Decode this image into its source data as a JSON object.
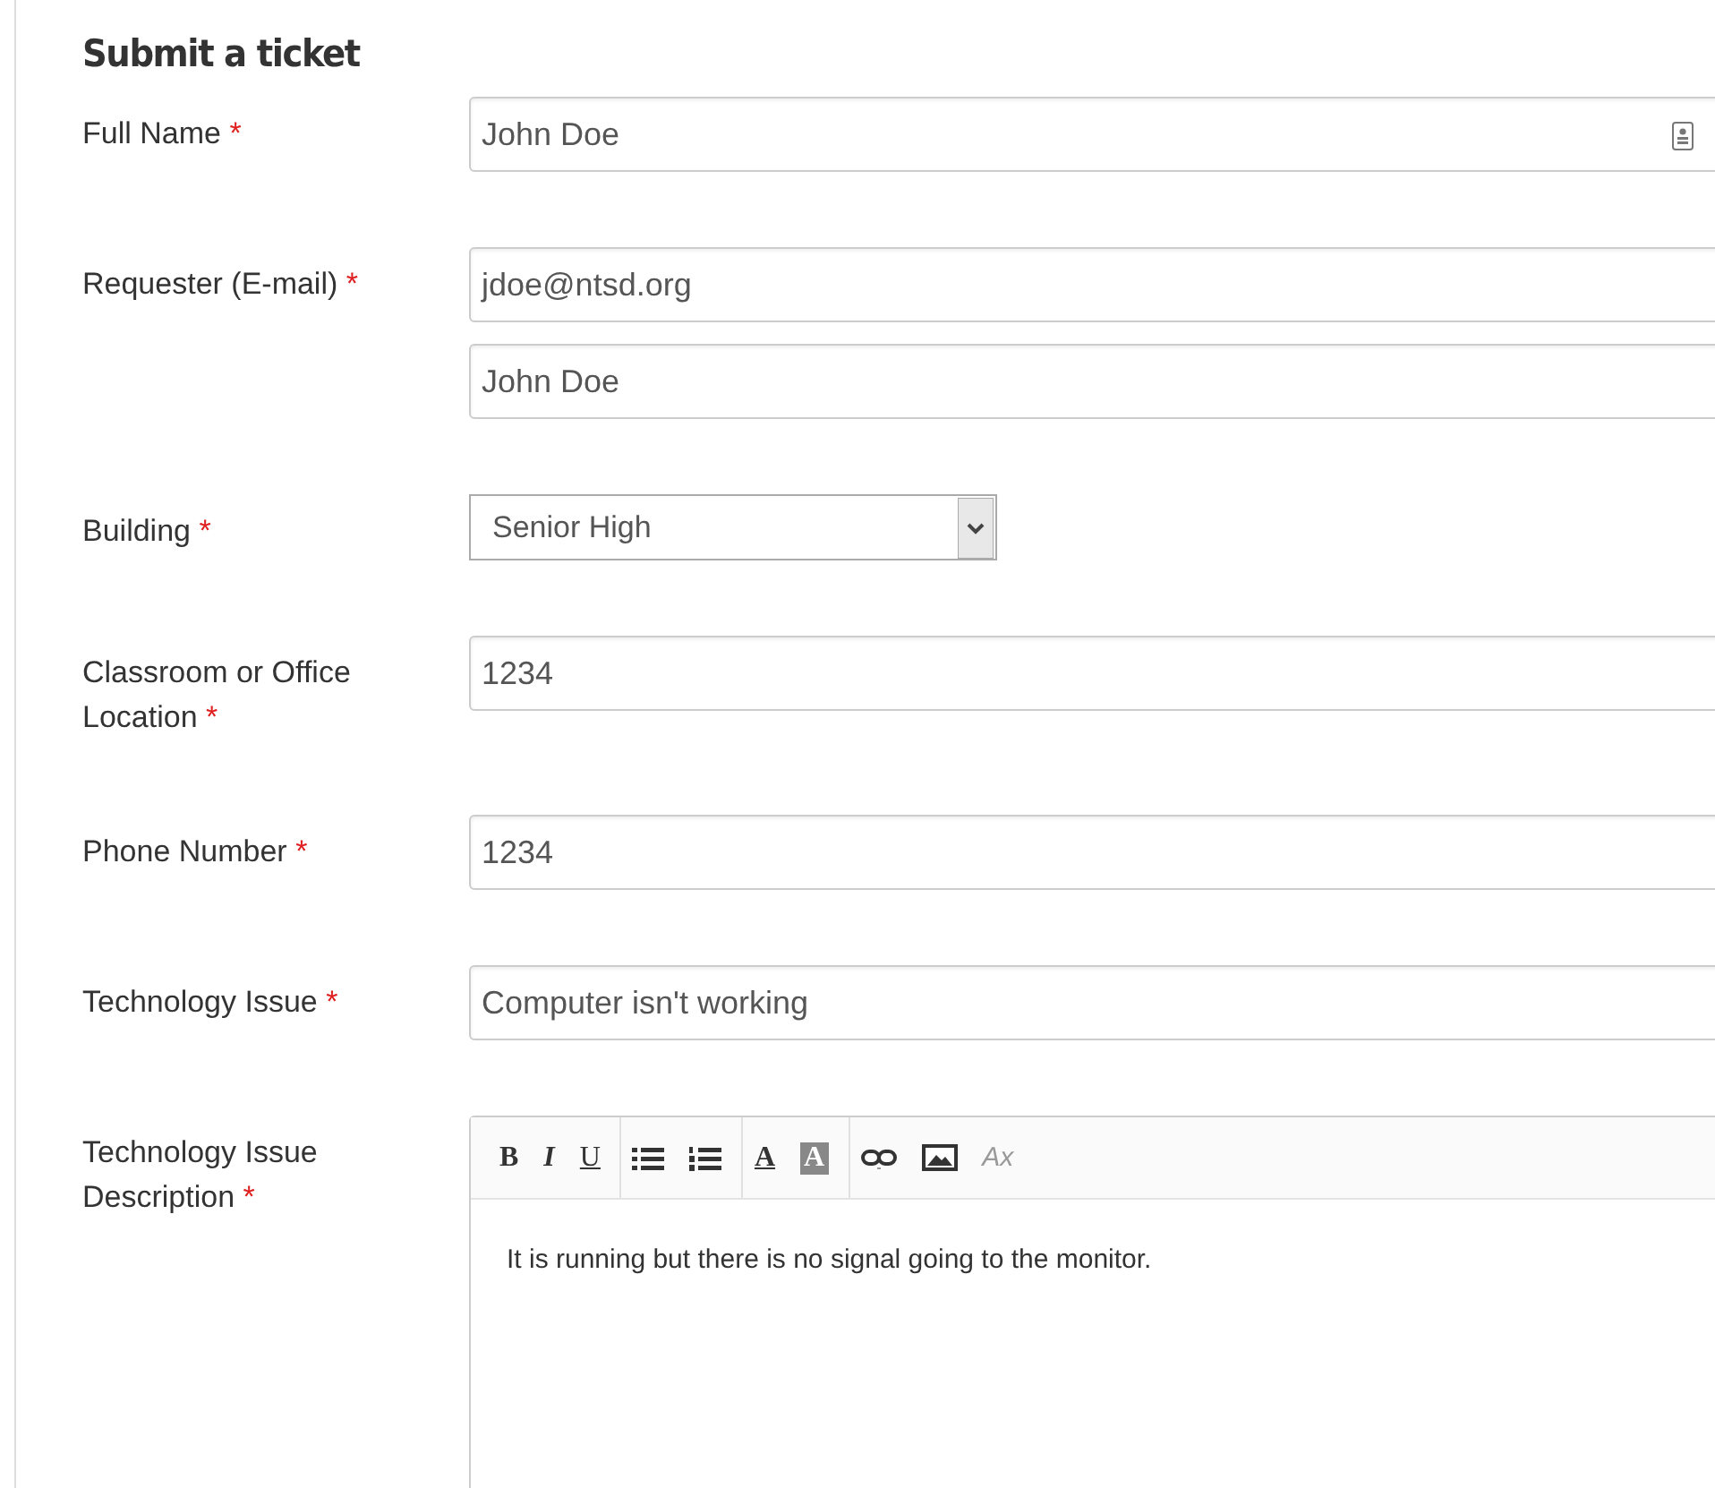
{
  "title": "Submit a ticket",
  "fields": [
    {
      "kind": "contact",
      "label": "Full Name",
      "required_mark": "*",
      "values": [
        "John Doe"
      ]
    },
    {
      "kind": "text",
      "label": "Requester (E-mail)",
      "required_mark": "*",
      "values": [
        "jdoe@ntsd.org",
        "John Doe"
      ]
    },
    {
      "kind": "select",
      "label": "Building",
      "required_mark": "*",
      "values": [
        "Senior High"
      ]
    },
    {
      "kind": "text",
      "label": "Classroom or Office Location",
      "required_mark": "*",
      "values": [
        "1234"
      ]
    },
    {
      "kind": "text",
      "label": "Phone Number",
      "required_mark": "*",
      "values": [
        "1234"
      ]
    },
    {
      "kind": "text",
      "label": "Technology Issue",
      "required_mark": "*",
      "values": [
        "Computer isn't working"
      ]
    },
    {
      "kind": "editor",
      "label": "Technology Issue Description",
      "required_mark": "*",
      "values": [
        "It is running but there is no signal going to the monitor."
      ],
      "toolbar": [
        [
          {
            "kind": "bold",
            "label": "B"
          },
          {
            "kind": "italic",
            "label": "I"
          },
          {
            "kind": "underline",
            "label": "U"
          }
        ],
        [
          {
            "kind": "bullet-list"
          },
          {
            "kind": "numbered-list"
          }
        ],
        [
          {
            "kind": "text-color",
            "label": "A"
          },
          {
            "kind": "background-color",
            "label": "A"
          }
        ],
        [
          {
            "kind": "link"
          },
          {
            "kind": "image"
          },
          {
            "kind": "remove-format",
            "label": "Ax"
          }
        ]
      ]
    }
  ]
}
